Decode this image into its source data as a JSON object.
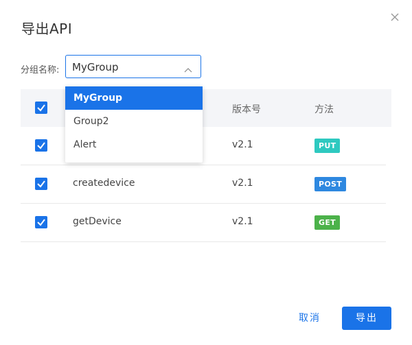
{
  "dialog": {
    "title": "导出API",
    "close_icon": "close-icon"
  },
  "group_select": {
    "label": "分组名称:",
    "value": "MyGroup",
    "options": [
      "MyGroup",
      "Group2",
      "Alert"
    ],
    "selected_option": "MyGroup"
  },
  "table": {
    "columns": {
      "name": "",
      "version": "版本号",
      "method": "方法"
    },
    "header_checked": true,
    "rows": [
      {
        "name": "",
        "version": "v2.1",
        "method": "PUT",
        "checked": true
      },
      {
        "name": "createdevice",
        "version": "v2.1",
        "method": "POST",
        "checked": true
      },
      {
        "name": "getDevice",
        "version": "v2.1",
        "method": "GET",
        "checked": true
      }
    ]
  },
  "colors": {
    "primary": "#1a73e8",
    "put": "#2ec9c0",
    "post": "#2e88e0",
    "get": "#4cb24a",
    "header_bg": "#f4f5f8"
  },
  "footer": {
    "cancel_label": "取消",
    "export_label": "导出"
  }
}
